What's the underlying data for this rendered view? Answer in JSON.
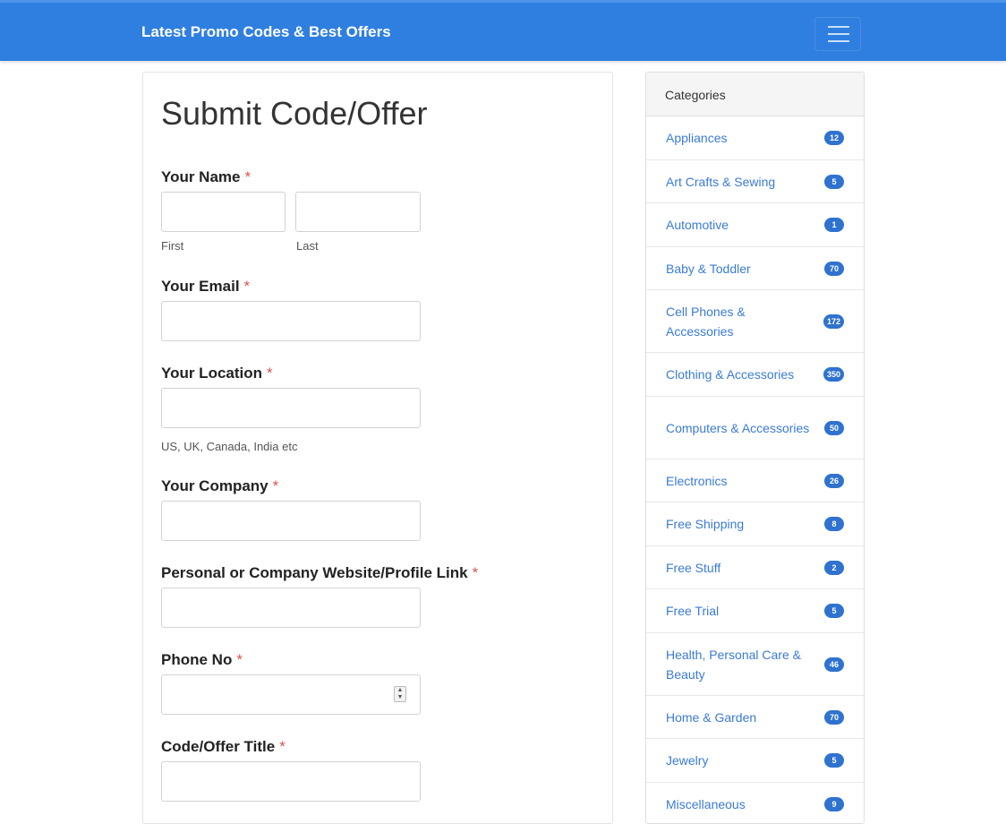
{
  "header": {
    "brand": "Latest Promo Codes & Best Offers",
    "menu_icon": "hamburger-icon",
    "color": "#2f7fe0"
  },
  "form": {
    "title": "Submit Code/Offer",
    "required_marker": "*",
    "name": {
      "label": "Your Name",
      "first_value": "",
      "last_value": "",
      "first_help": "First",
      "last_help": "Last"
    },
    "email": {
      "label": "Your Email",
      "value": ""
    },
    "location": {
      "label": "Your Location",
      "value": "",
      "help": "US, UK, Canada, India etc"
    },
    "company": {
      "label": "Your Company",
      "value": ""
    },
    "website": {
      "label": "Personal or Company Website/Profile Link",
      "value": ""
    },
    "phone": {
      "label": "Phone No",
      "value": ""
    },
    "offer_title": {
      "label": "Code/Offer Title",
      "value": ""
    }
  },
  "sidebar": {
    "title": "Categories",
    "badge_color": "#2f72cf",
    "items": [
      {
        "label": "Appliances",
        "count": "12"
      },
      {
        "label": "Art Crafts & Sewing",
        "count": "5"
      },
      {
        "label": "Automotive",
        "count": "1"
      },
      {
        "label": "Baby & Toddler",
        "count": "70"
      },
      {
        "label": "Cell Phones & Accessories",
        "count": "172"
      },
      {
        "label": "Clothing & Accessories",
        "count": "350"
      },
      {
        "label": "Computers & Accessories",
        "count": "50"
      },
      {
        "label": "Electronics",
        "count": "26"
      },
      {
        "label": "Free Shipping",
        "count": "8"
      },
      {
        "label": "Free Stuff",
        "count": "2"
      },
      {
        "label": "Free Trial",
        "count": "5"
      },
      {
        "label": "Health, Personal Care & Beauty",
        "count": "46"
      },
      {
        "label": "Home & Garden",
        "count": "70"
      },
      {
        "label": "Jewelry",
        "count": "5"
      },
      {
        "label": "Miscellaneous",
        "count": "9"
      }
    ]
  }
}
